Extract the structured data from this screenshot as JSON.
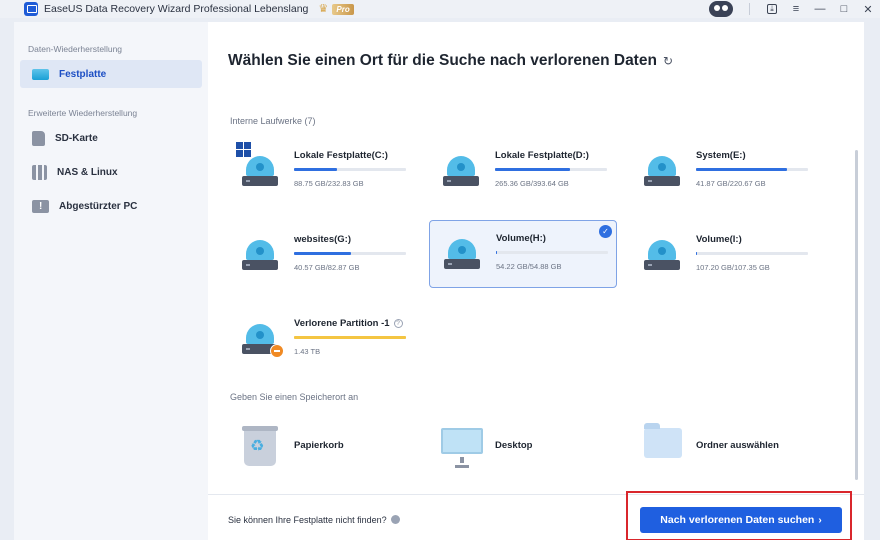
{
  "titlebar": {
    "app_title": "EaseUS Data Recovery Wizard Professional Lebenslang",
    "pro_label": "Pro",
    "buttons": {
      "download": "⤓",
      "menu": "≡",
      "minimize": "—",
      "maximize": "□",
      "close": "✕"
    }
  },
  "sidebar": {
    "heading_recovery": "Daten-Wiederherstellung",
    "heading_advanced": "Erweiterte Wiederherstellung",
    "items": [
      {
        "label": "Festplatte",
        "icon": "disk-icon",
        "active": true
      },
      {
        "label": "SD-Karte",
        "icon": "sd-card-icon",
        "active": false
      },
      {
        "label": "NAS & Linux",
        "icon": "nas-icon",
        "active": false
      },
      {
        "label": "Abgestürzter PC",
        "icon": "crashed-pc-icon",
        "active": false
      }
    ]
  },
  "main": {
    "title": "Wählen Sie einen Ort für die Suche nach verlorenen Daten",
    "refresh_glyph": "↻",
    "internal_label": "Interne Laufwerke (7)",
    "drives": [
      {
        "name": "Lokale Festplatte(C:)",
        "size": "88.75 GB/232.83 GB",
        "used_fraction": 0.38,
        "system": true
      },
      {
        "name": "Lokale Festplatte(D:)",
        "size": "265.36 GB/393.64 GB",
        "used_fraction": 0.67
      },
      {
        "name": "System(E:)",
        "size": "41.87 GB/220.67 GB",
        "used_fraction": 0.81
      },
      {
        "name": "websites(G:)",
        "size": "40.57 GB/82.87 GB",
        "used_fraction": 0.51
      },
      {
        "name": "Volume(H:)",
        "size": "54.22 GB/54.88 GB",
        "used_fraction": 0.01,
        "selected": true
      },
      {
        "name": "Volume(I:)",
        "size": "107.20 GB/107.35 GB",
        "used_fraction": 0.01
      },
      {
        "name": "Verlorene Partition -1",
        "size": "1.43 TB",
        "used_fraction": 1.0,
        "lost": true
      }
    ],
    "location_label": "Geben Sie einen Speicherort an",
    "locations": [
      {
        "name": "Papierkorb",
        "icon": "recycle-bin-icon"
      },
      {
        "name": "Desktop",
        "icon": "desktop-icon"
      },
      {
        "name": "Ordner auswählen",
        "icon": "folder-icon"
      }
    ]
  },
  "footer": {
    "hint": "Sie können Ihre Festplatte nicht finden?",
    "scan_button": "Nach verlorenen Daten suchen",
    "scan_arrow": "›"
  },
  "colors": {
    "accent": "#1f5fe0",
    "highlight": "#d9262c",
    "lost_bar": "#f4c542"
  }
}
